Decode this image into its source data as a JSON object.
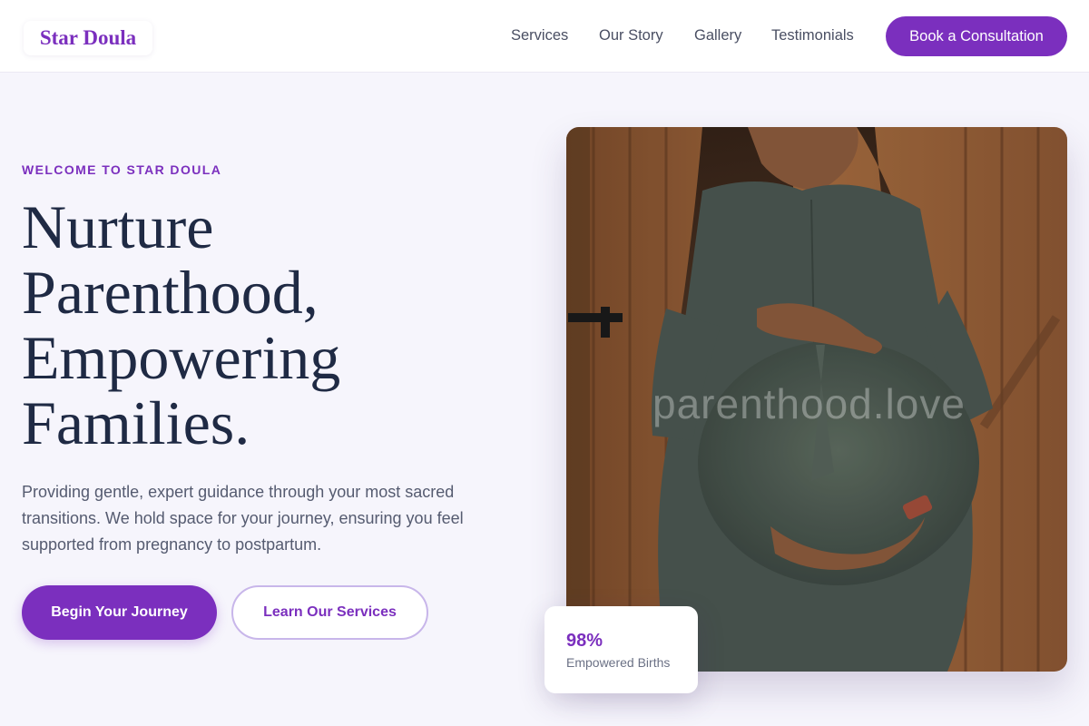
{
  "nav": {
    "logo": "Star Doula",
    "links": [
      "Services",
      "Our Story",
      "Gallery",
      "Testimonials"
    ],
    "cta": "Book a Consultation"
  },
  "hero": {
    "eyebrow": "WELCOME TO STAR DOULA",
    "headline_lines": [
      "Nurture",
      "Parenthood,",
      "Empowering",
      "Families."
    ],
    "lede": "Providing gentle, expert guidance through your most sacred transitions. We hold space for your journey, ensuring you feel supported from pregnancy to postpartum.",
    "primary_cta": "Begin Your Journey",
    "secondary_cta": "Learn Our Services"
  },
  "image": {
    "icon": "pregnant-woman-photo",
    "watermark": "parenthood.love"
  },
  "stat": {
    "value": "98%",
    "label": "Empowered Births"
  },
  "colors": {
    "accent": "#7b2fbe",
    "background": "#f6f5fc",
    "heading": "#1f2a44"
  }
}
